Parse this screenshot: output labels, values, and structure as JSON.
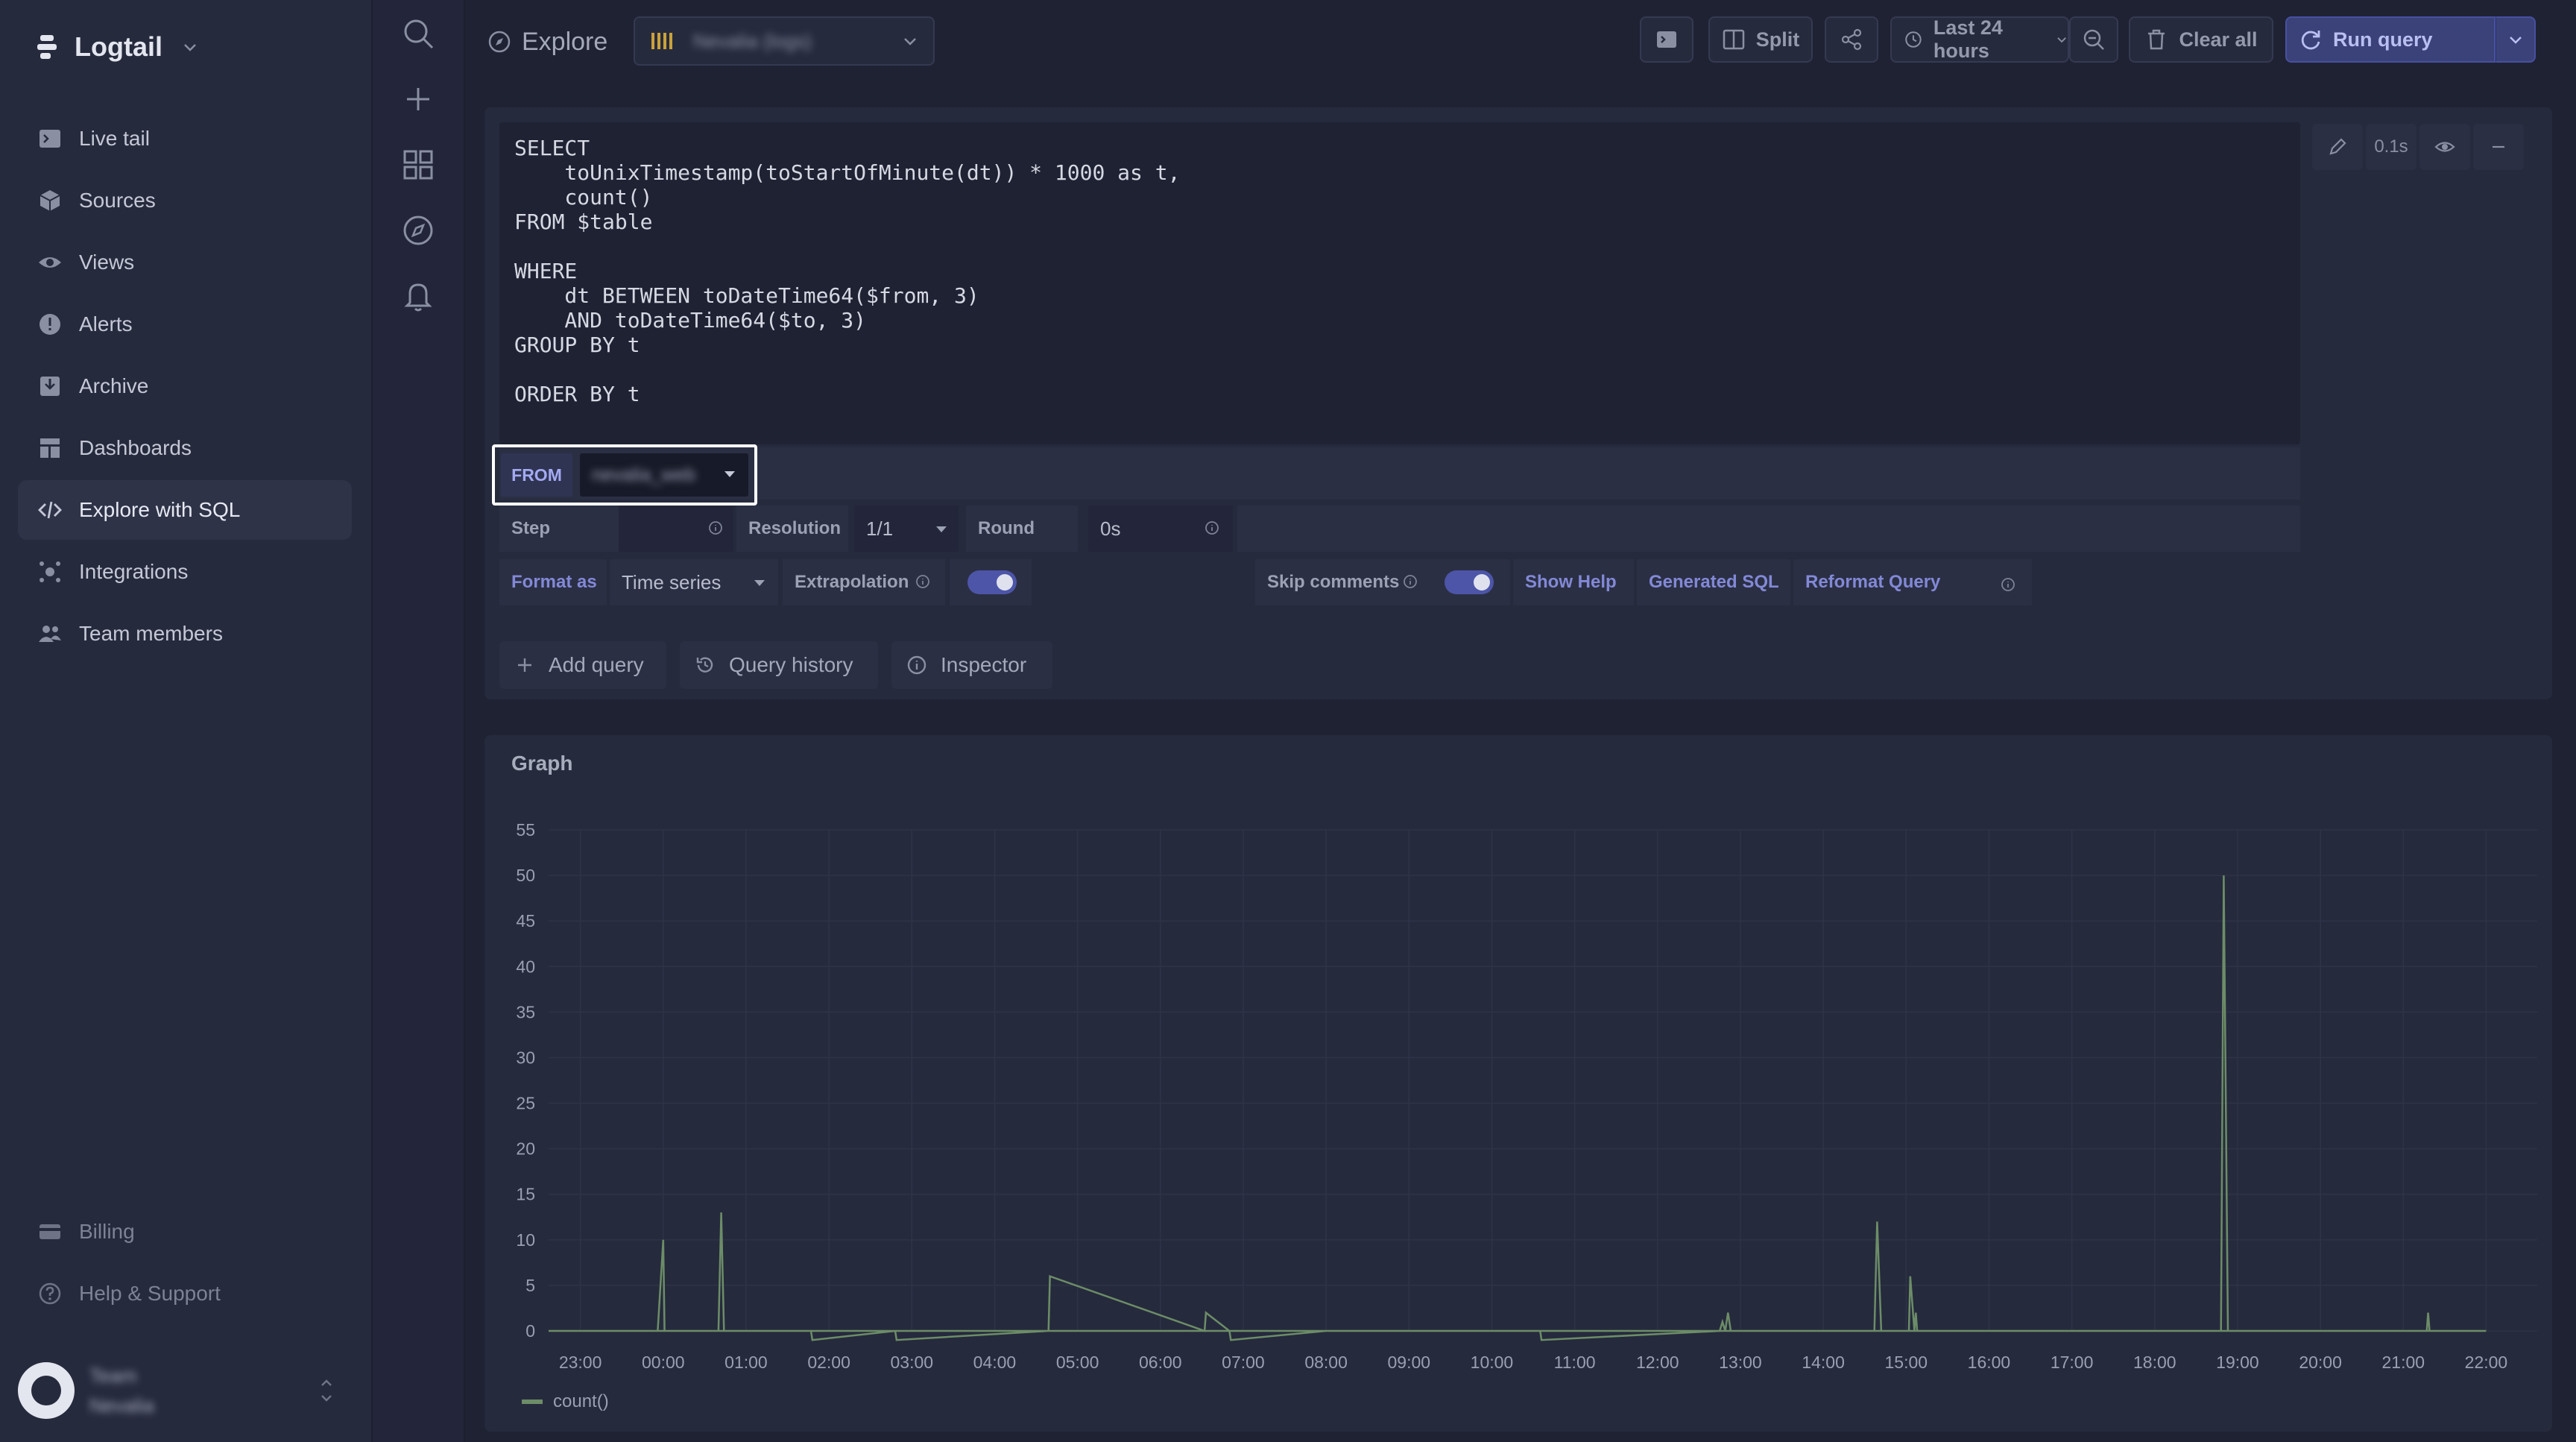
{
  "app": {
    "name": "Logtail"
  },
  "sidebar": {
    "items": [
      {
        "label": "Live tail",
        "icon": "terminal-icon"
      },
      {
        "label": "Sources",
        "icon": "cube-icon"
      },
      {
        "label": "Views",
        "icon": "eye-icon"
      },
      {
        "label": "Alerts",
        "icon": "alert-icon"
      },
      {
        "label": "Archive",
        "icon": "archive-icon"
      },
      {
        "label": "Dashboards",
        "icon": "dashboard-icon"
      },
      {
        "label": "Explore with SQL",
        "icon": "code-icon",
        "active": true
      },
      {
        "label": "Integrations",
        "icon": "integrations-icon"
      },
      {
        "label": "Team members",
        "icon": "users-icon"
      }
    ],
    "bottom": [
      {
        "label": "Billing",
        "icon": "card-icon"
      },
      {
        "label": "Help & Support",
        "icon": "help-icon"
      }
    ],
    "team": {
      "line1": "Team",
      "line2": "Nevalia"
    }
  },
  "topbar": {
    "title": "Explore",
    "source": "Nevalia (logs)",
    "split_label": "Split",
    "time_range": "Last 24 hours",
    "clear_label": "Clear all",
    "run_label": "Run query"
  },
  "editor": {
    "sql": "SELECT\n    toUnixTimestamp(toStartOfMinute(dt)) * 1000 as t,\n    count()\nFROM $table\n\nWHERE\n    dt BETWEEN toDateTime64($from, 3)\n    AND toDateTime64($to, 3)\nGROUP BY t\n\nORDER BY t",
    "time_label": "0.1s"
  },
  "query_options": {
    "from_label": "FROM",
    "from_value": "nevalia_web",
    "step_label": "Step",
    "resolution_label": "Resolution",
    "resolution_value": "1/1",
    "round_label": "Round",
    "round_value": "0s",
    "format_label": "Format as",
    "format_value": "Time series",
    "extrapolation_label": "Extrapolation",
    "skip_comments_label": "Skip comments",
    "show_help_label": "Show Help",
    "generated_sql_label": "Generated SQL",
    "reformat_label": "Reformat Query"
  },
  "actions": {
    "add_query": "Add query",
    "query_history": "Query history",
    "inspector": "Inspector"
  },
  "graph": {
    "title": "Graph",
    "legend": "count()"
  },
  "chart_data": {
    "type": "line",
    "y_ticks": [
      0,
      5,
      10,
      15,
      20,
      25,
      30,
      35,
      40,
      45,
      50,
      55
    ],
    "ylim": [
      0,
      55
    ],
    "x_ticks": [
      "23:00",
      "00:00",
      "01:00",
      "02:00",
      "03:00",
      "04:00",
      "05:00",
      "06:00",
      "07:00",
      "08:00",
      "09:00",
      "10:00",
      "11:00",
      "12:00",
      "13:00",
      "14:00",
      "15:00",
      "16:00",
      "17:00",
      "18:00",
      "19:00",
      "20:00",
      "21:00",
      "22:00"
    ],
    "grid": true,
    "line_color": "#6c8d67",
    "series": [
      {
        "name": "count()",
        "x": [
          "22:37",
          "23:56",
          "00:00",
          "00:01",
          "00:40",
          "00:42",
          "00:44",
          "01:47",
          "01:48",
          "02:48",
          "02:49",
          "04:39",
          "04:40",
          "06:32",
          "06:33",
          "06:50",
          "06:51",
          "08:00",
          "09:00",
          "10:35",
          "10:36",
          "12:45",
          "12:47",
          "12:49",
          "12:51",
          "12:53",
          "13:00",
          "13:05",
          "13:30",
          "14:37",
          "14:39",
          "14:42",
          "15:02",
          "15:03",
          "15:06",
          "15:07",
          "15:08",
          "15:10",
          "16:00",
          "17:00",
          "18:00",
          "18:48",
          "18:50",
          "18:53",
          "19:00",
          "20:00",
          "21:00",
          "21:17",
          "21:18",
          "21:19",
          "22:00",
          "22:37"
        ],
        "values": [
          0,
          0,
          10,
          0,
          0,
          13,
          0,
          0,
          -1,
          0,
          -1,
          0,
          6,
          0,
          2,
          0,
          -1,
          0,
          0,
          0,
          -1,
          0,
          1,
          0,
          2,
          0,
          0,
          0,
          0,
          0,
          12,
          0,
          0,
          6,
          0,
          2,
          0,
          0,
          0,
          0,
          0,
          0,
          50,
          0,
          0,
          0,
          0,
          0,
          2,
          0,
          0,
          0
        ]
      }
    ]
  }
}
